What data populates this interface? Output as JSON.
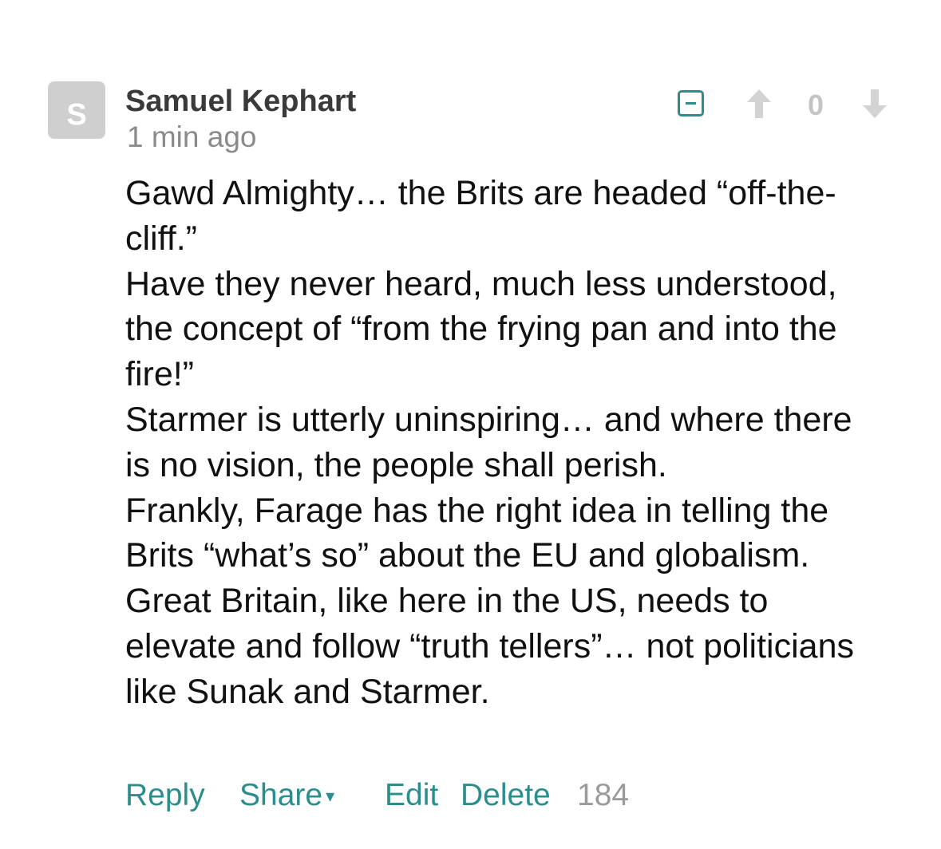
{
  "comment": {
    "avatar_letter": "S",
    "author": "Samuel Kephart",
    "timestamp": "1 min ago",
    "vote_count": "0",
    "paragraphs": [
      "Gawd Almighty… the Brits are headed “off-the-cliff.”",
      "Have they never heard, much less understood, the concept of “from the frying pan and into the fire!”",
      "Starmer is utterly uninspiring… and where there is no vision, the people shall perish.",
      "Frankly, Farage has the right idea in telling the Brits “what’s so” about the EU and globalism.",
      "Great Britain, like here in the US, needs to elevate and follow “truth tellers”… not politicians like Sunak and Starmer."
    ],
    "actions": {
      "reply": "Reply",
      "share": "Share",
      "share_arrow": "▾",
      "edit": "Edit",
      "delete": "Delete",
      "count": "184"
    }
  },
  "colors": {
    "accent": "#2a8f8c",
    "avatar_bg": "#cfcfcf",
    "muted": "#8a8a8a",
    "vote_icon": "#d3d3d3"
  },
  "icons": {
    "collapse": "collapse-icon",
    "upvote": "arrow-up-icon",
    "downvote": "arrow-down-icon"
  }
}
